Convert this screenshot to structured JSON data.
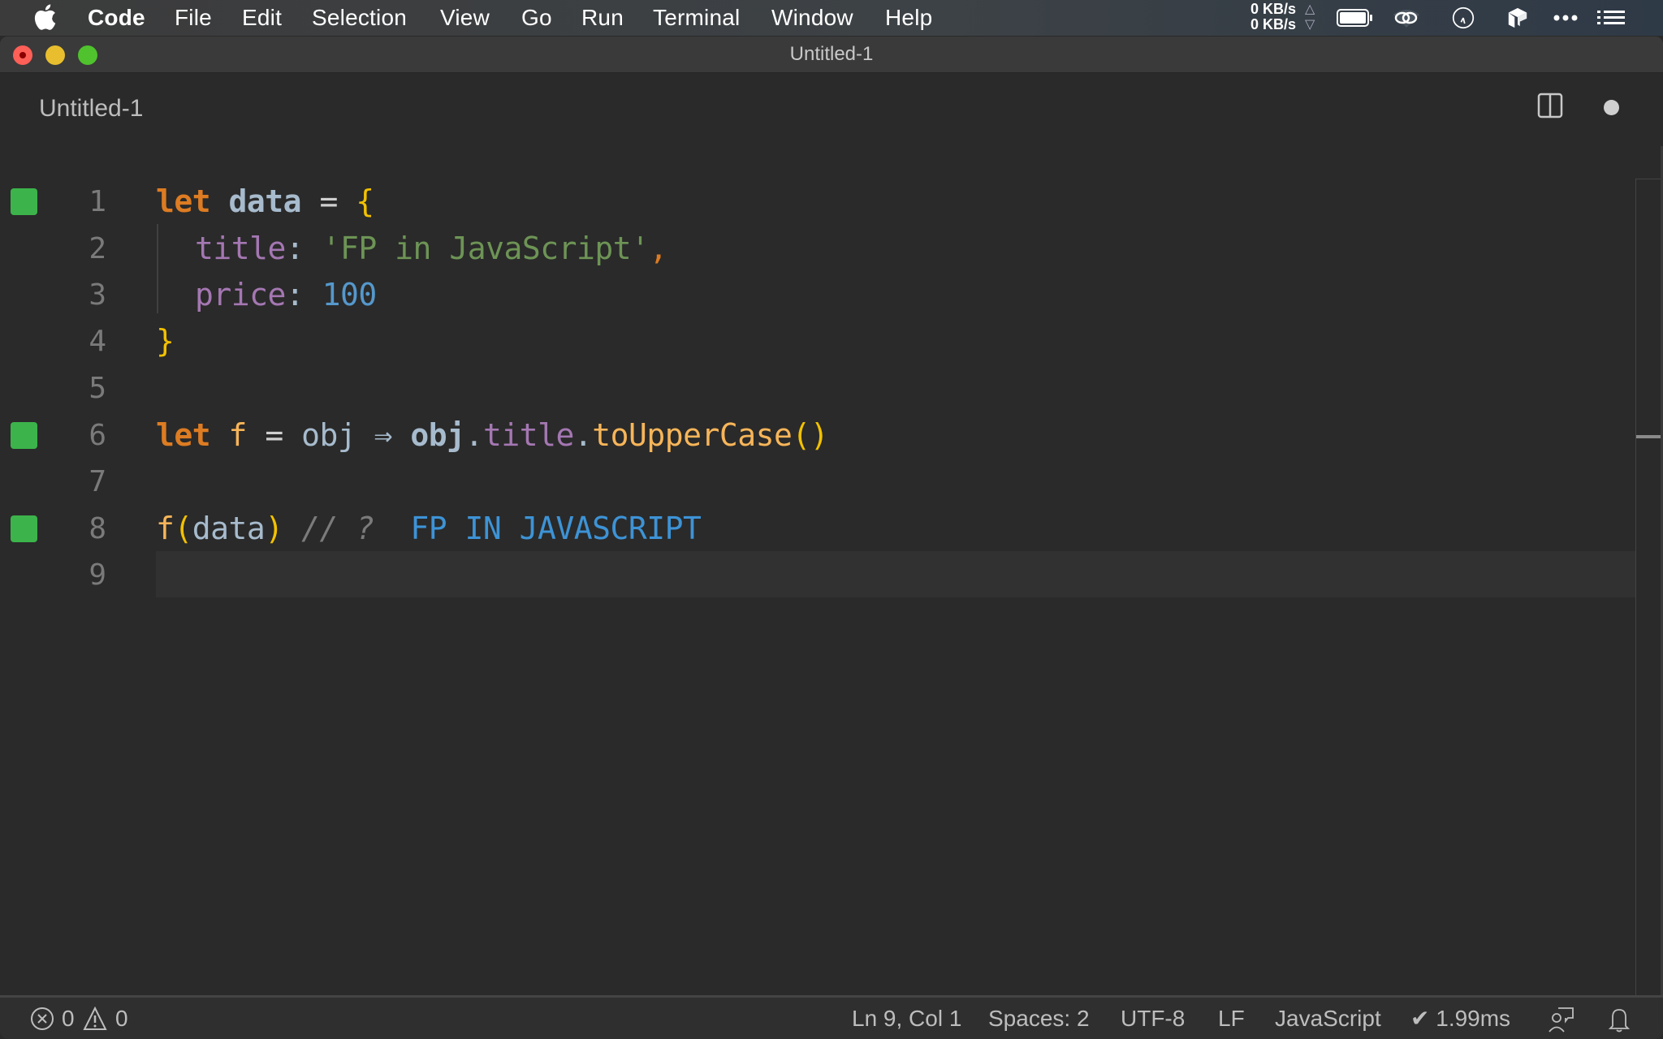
{
  "menubar": {
    "app_name": "Code",
    "items": [
      "File",
      "Edit",
      "Selection",
      "View",
      "Go",
      "Run",
      "Terminal",
      "Window",
      "Help"
    ],
    "net_up": "0 KB/s",
    "net_down": "0 KB/s",
    "net_up_arrow": "△",
    "net_down_arrow": "▽",
    "tray_icons": [
      "battery-icon",
      "creative-cloud-icon",
      "clock-icon",
      "dropbox-icon",
      "more-icon",
      "list-icon"
    ]
  },
  "window": {
    "title": "Untitled-1"
  },
  "tab": {
    "label": "Untitled-1",
    "dirty": true
  },
  "editor": {
    "lines": [
      {
        "number": "1",
        "marker": true
      },
      {
        "number": "2",
        "marker": false
      },
      {
        "number": "3",
        "marker": false
      },
      {
        "number": "4",
        "marker": false
      },
      {
        "number": "5",
        "marker": false
      },
      {
        "number": "6",
        "marker": true
      },
      {
        "number": "7",
        "marker": false
      },
      {
        "number": "8",
        "marker": true
      },
      {
        "number": "9",
        "marker": false
      }
    ],
    "code": {
      "l1": {
        "kw": "let",
        "name": "data",
        "op": "=",
        "brace": "{"
      },
      "l2": {
        "prop": "title",
        "colon": ":",
        "str": "'FP in JavaScript'",
        "comma": ","
      },
      "l3": {
        "prop": "price",
        "colon": ":",
        "num": "100"
      },
      "l4": {
        "brace": "}"
      },
      "l6": {
        "kw": "let",
        "fname": "f",
        "op": "=",
        "param": "obj",
        "arrow": "⇒",
        "obj": "obj",
        "dot1": ".",
        "prop": "title",
        "dot2": ".",
        "method": "toUpperCase",
        "paren_open": "(",
        "paren_close": ")"
      },
      "l8": {
        "fname": "f",
        "paren_open": "(",
        "arg": "data",
        "paren_close": ")",
        "comment": "// ?",
        "result": "FP IN JAVASCRIPT"
      }
    },
    "current_line": 9,
    "gutter_marker_color": "#3cb44b"
  },
  "statusbar": {
    "errors": "0",
    "warnings": "0",
    "cursor": "Ln 9, Col 1",
    "indent": "Spaces: 2",
    "encoding": "UTF-8",
    "eol": "LF",
    "language": "JavaScript",
    "timing": "✔ 1.99ms"
  }
}
